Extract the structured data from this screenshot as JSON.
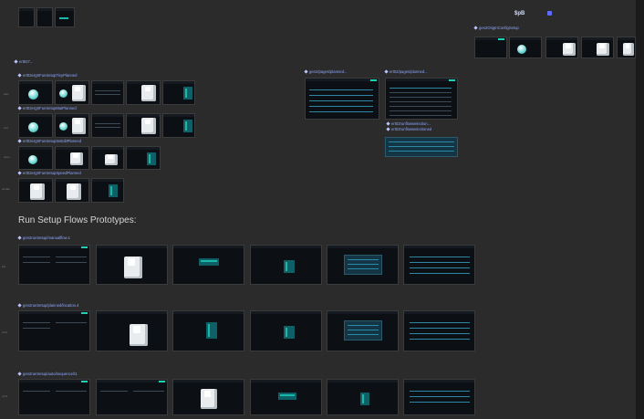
{
  "page": {
    "heading": "Run Setup Flows Prototypes:",
    "accent": "#1fd0b5",
    "label_color": "#8ea6ff"
  },
  "labels": {
    "top_config": "gen2OrigtnConfigSetup",
    "top_logo": "$pB",
    "section_small": "ert827...",
    "r1": "ert02ergtrFunSetupTinyPlanned",
    "r2": "ert02ergtrFunSetupMatPlanned",
    "r3": "ert02ergtrFunSetupSeEditPlanned",
    "r4": "ert02ergtrFunSetupSpeedPlanned",
    "gen2pages": "gen2/pages/planned...",
    "ert02pages": "ert02/pages/planned...",
    "runflow": "ert02runflowselection...",
    "runflow2": "ert02runflowselectioned",
    "flow1": "gen2runSetup/manualflow.1",
    "flow2": "gen2runSetup/planned/location.4",
    "flow3": "gen2runSetup/auto/sequence/t1"
  },
  "side_labels": [
    "plan",
    "sort",
    "done",
    "shuttle"
  ],
  "flow_side": [
    "left",
    "run2",
    "run3"
  ]
}
